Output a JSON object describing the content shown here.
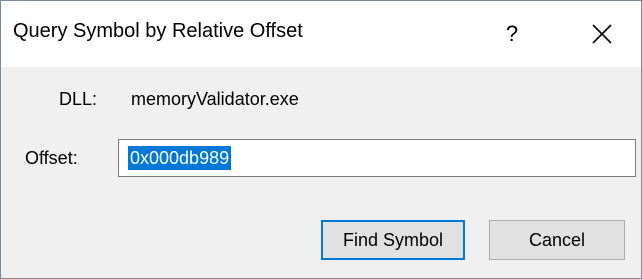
{
  "dialog": {
    "title": "Query Symbol by Relative Offset",
    "help_glyph": "?",
    "close_icon": "close-icon"
  },
  "dll": {
    "label": "DLL:",
    "value": "memoryValidator.exe"
  },
  "offset": {
    "label": "Offset:",
    "value": "0x000db989",
    "selected": true
  },
  "buttons": {
    "find_label": "Find Symbol",
    "cancel_label": "Cancel"
  },
  "colors": {
    "selection": "#0078d7",
    "dialog_bg": "#f0f0f0",
    "titlebar_bg": "#ffffff"
  }
}
